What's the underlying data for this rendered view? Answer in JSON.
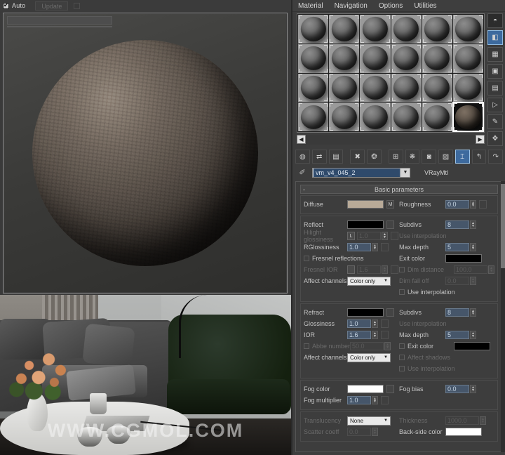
{
  "left": {
    "auto_label": "Auto",
    "update_label": "Update",
    "auto_checked": true,
    "watermark": "WWW.CGMOL.COM"
  },
  "editor": {
    "menus": [
      "Material",
      "Navigation",
      "Options",
      "Utilities"
    ],
    "slots": {
      "rows": 4,
      "cols": 6,
      "selected_index": 23
    },
    "nav": {
      "left": "◀",
      "right": "▶"
    },
    "toolbar_icons": [
      "get-material-icon",
      "put-material-to-scene-icon",
      "assign-material-icon",
      "reset-map-icon",
      "make-material-copy-icon",
      "make-unique-icon",
      "put-to-library-icon",
      "material-effects-channel-icon",
      "show-map-in-viewport-icon",
      "show-end-result-icon",
      "go-to-parent-icon",
      "go-forward-to-sibling-icon"
    ],
    "side_icons": [
      "sample-type-icon",
      "backlight-icon",
      "background-icon",
      "sample-uv-tiling-icon",
      "video-color-check-icon",
      "make-preview-icon",
      "options-icon",
      "select-by-material-icon",
      "material-map-navigator-icon"
    ],
    "material_name": "vm_v4_045_2",
    "material_type": "VRayMtl",
    "rollout_title": "Basic parameters",
    "rollout_toggle": "-",
    "basic": {
      "diffuse_label": "Diffuse",
      "diffuse_map_btn": "M",
      "roughness_label": "Roughness",
      "roughness_value": "0.0"
    },
    "reflect": {
      "reflect_label": "Reflect",
      "hglossiness_label": "Hilight glossiness",
      "hglossiness_value": "1.0",
      "lock_label": "L",
      "rglossiness_label": "RGlossiness",
      "rglossiness_value": "1.0",
      "fresnel_label": "Fresnel reflections",
      "fresnel_ior_label": "Fresnel IOR",
      "fresnel_ior_value": "1.6",
      "affect_channels_label": "Affect channels",
      "affect_channels_value": "Color only",
      "subdivs_label": "Subdivs",
      "subdivs_value": "8",
      "use_interpolation_top_label": "Use interpolation",
      "max_depth_label": "Max depth",
      "max_depth_value": "5",
      "exit_color_label": "Exit color",
      "dim_distance_label": "Dim distance",
      "dim_distance_value": "100.0",
      "dim_falloff_label": "Dim fall off",
      "dim_falloff_value": "0.0",
      "use_interpolation_label": "Use interpolation"
    },
    "refract": {
      "refract_label": "Refract",
      "glossiness_label": "Glossiness",
      "glossiness_value": "1.0",
      "ior_label": "IOR",
      "ior_value": "1.6",
      "abbe_label": "Abbe number",
      "abbe_value": "50.0",
      "affect_channels_label": "Affect channels",
      "affect_channels_value": "Color only",
      "subdivs_label": "Subdivs",
      "subdivs_value": "8",
      "use_interpolation_top_label": "Use interpolation",
      "max_depth_label": "Max depth",
      "max_depth_value": "5",
      "exit_color_label": "Exit color",
      "affect_shadows_label": "Affect shadows",
      "use_interpolation_label": "Use interpolation"
    },
    "fog": {
      "fog_color_label": "Fog color",
      "fog_multiplier_label": "Fog multiplier",
      "fog_multiplier_value": "1.0",
      "fog_bias_label": "Fog bias",
      "fog_bias_value": "0.0"
    },
    "translucency": {
      "translucency_label": "Translucency",
      "translucency_value": "None",
      "thickness_label": "Thickness",
      "thickness_value": "1000.0",
      "scatter_coeff_label": "Scatter coeff",
      "scatter_coeff_value": "0.0",
      "back_side_color_label": "Back-side color"
    },
    "colors": {
      "accent_blue": "#3d6a9e",
      "field_blue": "#46566a",
      "panel_bg": "#3d3d3d"
    }
  }
}
